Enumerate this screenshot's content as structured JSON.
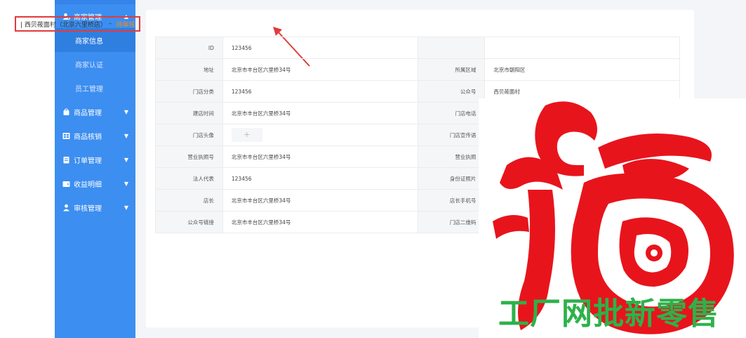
{
  "sidebar": {
    "items": [
      {
        "label": "商家管理",
        "icon": "user-icon",
        "arrow": "▲",
        "children": [
          {
            "label": "商家信息",
            "active": true
          },
          {
            "label": "商家认证",
            "active": false
          },
          {
            "label": "员工管理",
            "active": false
          }
        ]
      },
      {
        "label": "商品管理",
        "icon": "bag-icon",
        "arrow": "▼"
      },
      {
        "label": "商品核销",
        "icon": "grid-icon",
        "arrow": "▼"
      },
      {
        "label": "订单管理",
        "icon": "clipboard-icon",
        "arrow": "▼"
      },
      {
        "label": "收益明细",
        "icon": "wallet-icon",
        "arrow": "▼"
      },
      {
        "label": "审核管理",
        "icon": "person-icon",
        "arrow": "▼"
      }
    ]
  },
  "header": {
    "title": "| 西贝莜面村（北京六里桥店）",
    "separator": "–",
    "status": "待审核"
  },
  "rows": [
    {
      "l1": "ID",
      "v1": "123456",
      "l2": "",
      "v2": ""
    },
    {
      "l1": "地址",
      "v1": "北京市丰台区六里桥34号",
      "l2": "所属区域",
      "v2": "北京市朝阳区"
    },
    {
      "l1": "门店分类",
      "v1": "123456",
      "l2": "公众号",
      "v2": "西贝莜面村"
    },
    {
      "l1": "建店时间",
      "v1": "北京市丰台区六里桥34号",
      "l2": "门店电话",
      "v2": ""
    },
    {
      "l1": "门店头像",
      "v1": "+",
      "l2": "门店宣传语",
      "v2": ""
    },
    {
      "l1": "营业执照号",
      "v1": "北京市丰台区六里桥34号",
      "l2": "营业执照",
      "v2": ""
    },
    {
      "l1": "法人代表",
      "v1": "123456",
      "l2": "身份证照片",
      "v2": ""
    },
    {
      "l1": "店长",
      "v1": "北京市丰台区六里桥34号",
      "l2": "店长手机号",
      "v2": ""
    },
    {
      "l1": "公众号链接",
      "v1": "北京市丰台区六里桥34号",
      "l2": "门店二维码",
      "v2": ""
    }
  ],
  "overlay": {
    "watermark": "工厂网批新零售"
  },
  "colors": {
    "sidebar": "#3c8ef0",
    "sidebar_active": "#2f7fe0",
    "highlight_box": "#e23b3b",
    "status": "#f08c1a",
    "fu_red": "#e8141c",
    "watermark_green": "#2db24a"
  }
}
